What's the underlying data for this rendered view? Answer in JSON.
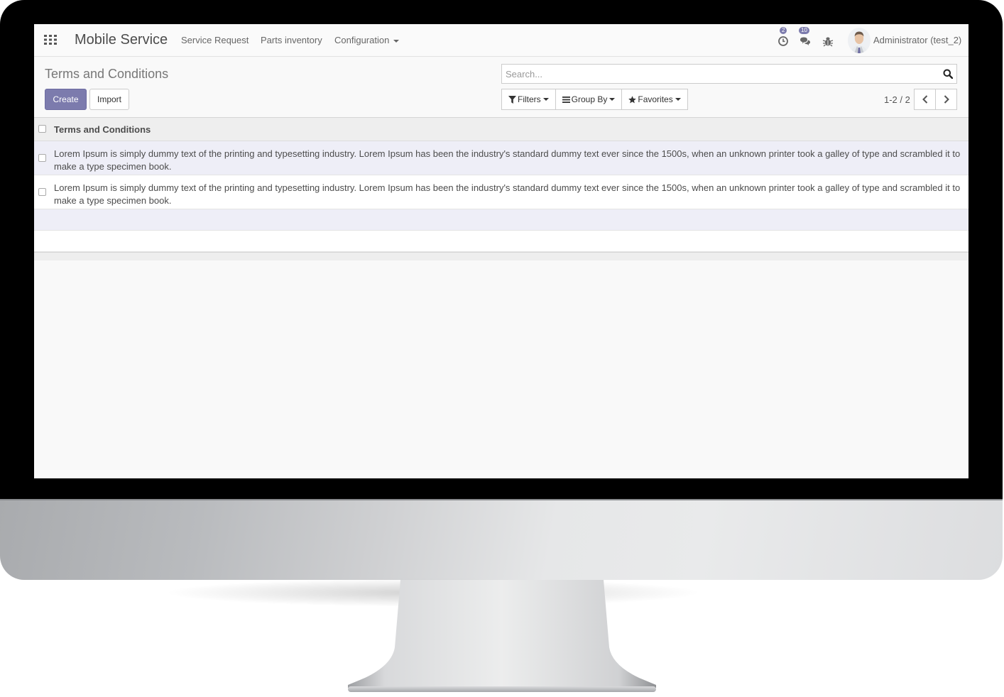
{
  "navbar": {
    "app_title": "Mobile Service",
    "menu": [
      "Service Request",
      "Parts inventory",
      "Configuration"
    ],
    "activity_count": "2",
    "messages_count": "10",
    "user": "Administrator (test_2)"
  },
  "control_panel": {
    "breadcrumb": "Terms and Conditions",
    "create_label": "Create",
    "import_label": "Import",
    "search_placeholder": "Search...",
    "filters_label": "Filters",
    "groupby_label": "Group By",
    "favorites_label": "Favorites",
    "pager_value": "1-2 / 2"
  },
  "list": {
    "column": "Terms and Conditions",
    "rows": [
      "Lorem Ipsum is simply dummy text of the printing and typesetting industry. Lorem Ipsum has been the industry's standard dummy text ever since the 1500s, when an unknown printer took a galley of type and scrambled it to make a type specimen book.",
      "Lorem Ipsum is simply dummy text of the printing and typesetting industry. Lorem Ipsum has been the industry's standard dummy text ever since the 1500s, when an unknown printer took a galley of type and scrambled it to make a type specimen book."
    ]
  },
  "colors": {
    "brand": "#7c7bad",
    "text": "#4c4c4c",
    "row_highlight": "#eeeef7"
  },
  "icons": [
    "apps-grid-icon",
    "clock-icon",
    "chat-icon",
    "bug-icon",
    "search-icon",
    "filter-icon",
    "list-icon",
    "star-icon",
    "chevron-left-icon",
    "chevron-right-icon"
  ]
}
